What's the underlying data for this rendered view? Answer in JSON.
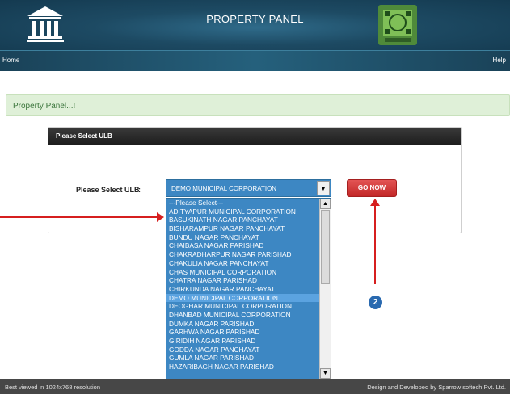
{
  "header": {
    "title": "PROPERTY PANEL",
    "logo_icon": "bank-building-icon",
    "emblem_icon": "state-emblem-icon"
  },
  "nav": {
    "home": "Home",
    "help": "Help"
  },
  "alert": {
    "text": "Property Panel...!"
  },
  "panel": {
    "heading": "Please Select ULB",
    "label": "Please Select ULB",
    "colon": ":",
    "select_value": "DEMO MUNICIPAL CORPORATION",
    "go_button": "GO NOW"
  },
  "dropdown": {
    "options": [
      "---Please Select---",
      "ADITYAPUR MUNICIPAL CORPORATION",
      "BASUKINATH NAGAR PANCHAYAT",
      "BISHARAMPUR NAGAR PANCHAYAT",
      "BUNDU NAGAR PANCHAYAT",
      "CHAIBASA NAGAR PARISHAD",
      "CHAKRADHARPUR NAGAR PARISHAD",
      "CHAKULIA NAGAR PANCHAYAT",
      "CHAS MUNICIPAL CORPORATION",
      "CHATRA NAGAR PARISHAD",
      "CHIRKUNDA NAGAR PANCHAYAT",
      "DEMO MUNICIPAL CORPORATION",
      "DEOGHAR MUNICIPAL CORPORATION",
      "DHANBAD MUNICIPAL CORPORATION",
      "DUMKA NAGAR PARISHAD",
      "GARHWA NAGAR PARISHAD",
      "GIRIDIH NAGAR PARISHAD",
      "GODDA NAGAR PANCHAYAT",
      "GUMLA NAGAR PARISHAD",
      "HAZARIBAGH NAGAR PARISHAD"
    ],
    "selected_index": 11
  },
  "annotation": {
    "step_number": "2",
    "color": "#d61f1f"
  },
  "footer": {
    "left": "Best viewed in 1024x768 resolution",
    "right": "Design and Developed by Sparrow softech Pvt. Ltd."
  },
  "colors": {
    "header": "#1d4a63",
    "select": "#3d87c3",
    "button": "#c22727",
    "footer": "#474747"
  }
}
